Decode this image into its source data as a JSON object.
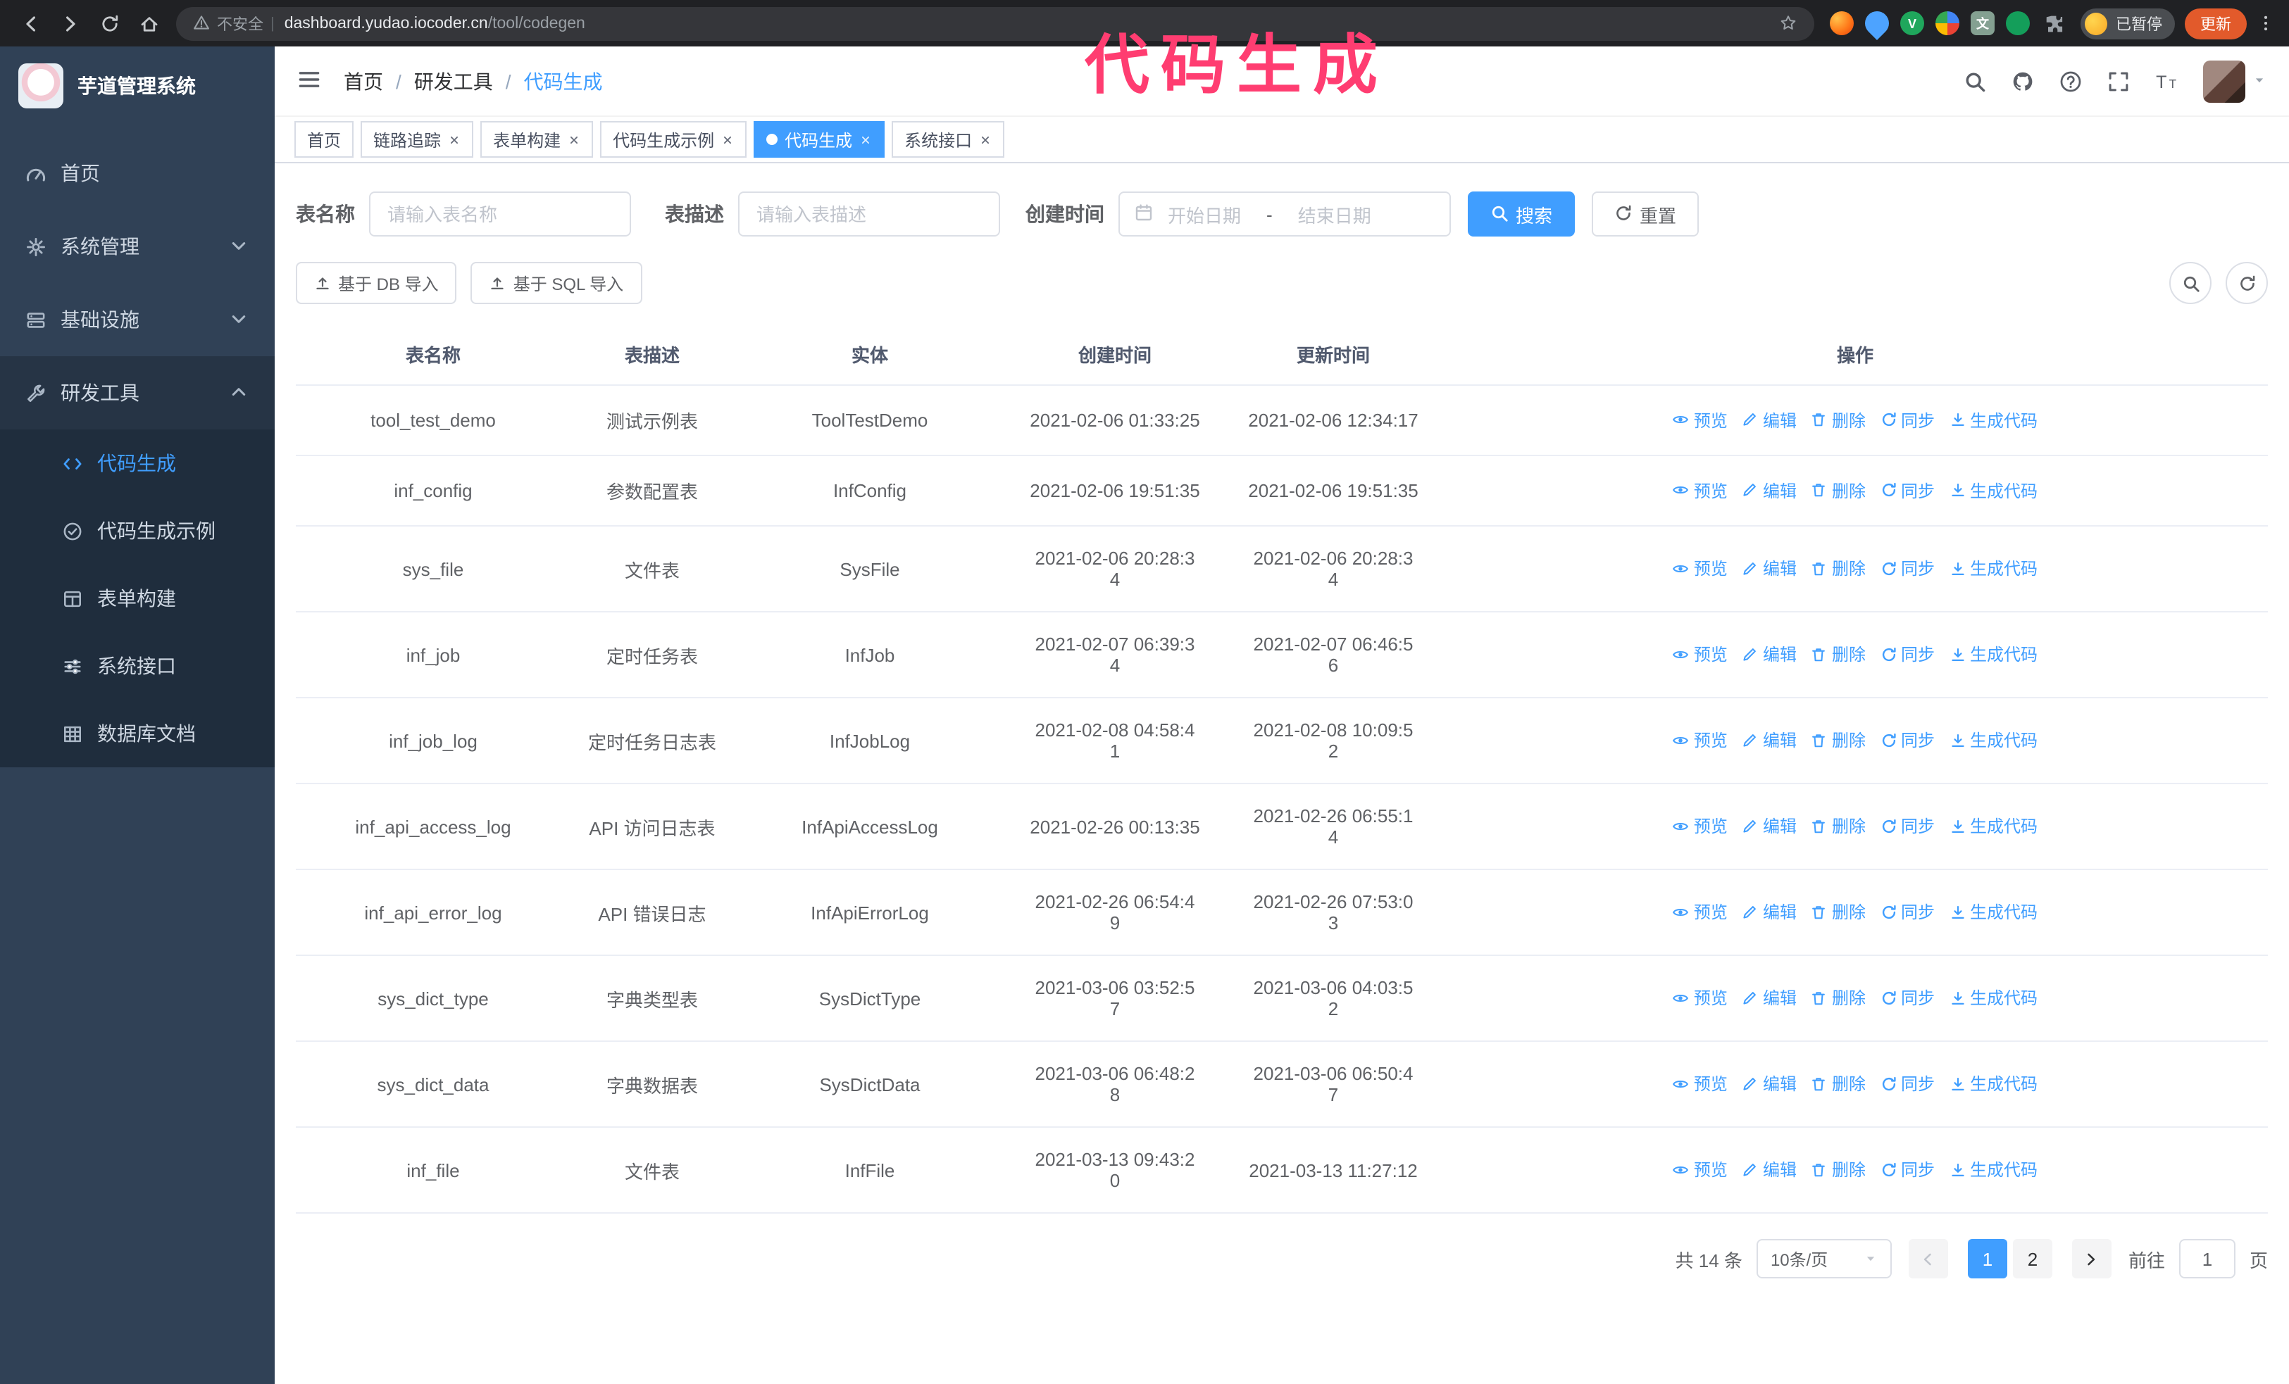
{
  "annotation": {
    "text": "代码生成"
  },
  "colors": {
    "accent": "#409eff",
    "sidebar_bg": "#304156",
    "submenu_bg": "#1f2d3d",
    "annotation": "#ff3d71",
    "update_button_bg": "#e25a2b",
    "chrome_bg": "#202124"
  },
  "browser": {
    "nav_icons": [
      "arrow-left-icon",
      "arrow-right-icon",
      "reload-icon",
      "home-icon"
    ],
    "warning_icon": "warning-icon",
    "security_label": "不安全",
    "url_domain": "dashboard.yudao.iocoder.cn",
    "url_path": "/tool/codegen",
    "bookmark_icon": "star-icon",
    "extensions": [
      {
        "name": "fox-extension-icon",
        "color": "#ff7a1a",
        "glyph": ""
      },
      {
        "name": "drop-extension-icon",
        "color": "#4da3ff",
        "glyph": ""
      },
      {
        "name": "check-extension-icon",
        "color": "#1fa75c",
        "glyph": "V"
      },
      {
        "name": "people-extension-icon",
        "color": "#4285f4",
        "glyph": ""
      },
      {
        "name": "translate-extension-icon",
        "color": "#84a091",
        "glyph": "文"
      },
      {
        "name": "leaf-extension-icon",
        "color": "#149e5a",
        "glyph": ""
      },
      {
        "name": "puzzle-extension-icon",
        "color": "#9aa0a6",
        "glyph": ""
      }
    ],
    "profile_badge": "已暂停",
    "update_button": "更新",
    "more_icon": "more-vert-icon"
  },
  "sidebar": {
    "logo_title": "芋道管理系统",
    "menu": [
      {
        "key": "home",
        "label": "首页",
        "icon": "dashboard-icon"
      },
      {
        "key": "system",
        "label": "系统管理",
        "icon": "gear-icon",
        "chevron": "down"
      },
      {
        "key": "infra",
        "label": "基础设施",
        "icon": "server-icon",
        "chevron": "down"
      },
      {
        "key": "devtools",
        "label": "研发工具",
        "icon": "wrench-icon",
        "chevron": "up",
        "open": true,
        "children": [
          {
            "key": "codegen",
            "label": "代码生成",
            "icon": "code-icon",
            "active": true
          },
          {
            "key": "codegen-example",
            "label": "代码生成示例",
            "icon": "badge-check-icon"
          },
          {
            "key": "form-builder",
            "label": "表单构建",
            "icon": "form-icon"
          },
          {
            "key": "system-api",
            "label": "系统接口",
            "icon": "sliders-icon"
          },
          {
            "key": "db-doc",
            "label": "数据库文档",
            "icon": "grid-icon"
          }
        ]
      }
    ]
  },
  "navbar": {
    "hamburger_icon": "hamburger-icon",
    "breadcrumb": [
      "首页",
      "研发工具",
      "代码生成"
    ],
    "right_icons": [
      "search-icon",
      "github-icon",
      "help-icon",
      "fullscreen-icon",
      "font-size-icon"
    ],
    "avatar_caret": "caret-down-icon"
  },
  "tabs": [
    {
      "key": "home",
      "label": "首页",
      "closable": false,
      "active": false
    },
    {
      "key": "trace",
      "label": "链路追踪",
      "closable": true,
      "active": false
    },
    {
      "key": "form-builder",
      "label": "表单构建",
      "closable": true,
      "active": false
    },
    {
      "key": "codegen-example",
      "label": "代码生成示例",
      "closable": true,
      "active": false
    },
    {
      "key": "codegen",
      "label": "代码生成",
      "closable": true,
      "active": true
    },
    {
      "key": "system-api",
      "label": "系统接口",
      "closable": true,
      "active": false
    }
  ],
  "filters": {
    "table_name_label": "表名称",
    "table_name_placeholder": "请输入表名称",
    "table_desc_label": "表描述",
    "table_desc_placeholder": "请输入表描述",
    "create_time_label": "创建时间",
    "calendar_icon": "calendar-icon",
    "date_start_placeholder": "开始日期",
    "date_separator": "-",
    "date_end_placeholder": "结束日期",
    "search_icon": "search-icon",
    "search_label": "搜索",
    "reset_icon": "reload-icon",
    "reset_label": "重置"
  },
  "toolbar": {
    "import_icon": "upload-icon",
    "import_db_label": "基于 DB 导入",
    "import_sql_label": "基于 SQL 导入",
    "circle_icons": [
      "search-icon",
      "reload-icon"
    ]
  },
  "table": {
    "columns": [
      "表名称",
      "表描述",
      "实体",
      "创建时间",
      "更新时间",
      "操作"
    ],
    "ops": [
      {
        "key": "preview",
        "label": "预览",
        "icon": "eye-icon"
      },
      {
        "key": "edit",
        "label": "编辑",
        "icon": "edit-icon"
      },
      {
        "key": "delete",
        "label": "删除",
        "icon": "delete-icon"
      },
      {
        "key": "sync",
        "label": "同步",
        "icon": "sync-icon"
      },
      {
        "key": "generate",
        "label": "生成代码",
        "icon": "download-icon"
      }
    ],
    "rows": [
      {
        "name": "tool_test_demo",
        "desc": "测试示例表",
        "entity": "ToolTestDemo",
        "created": "2021-02-06 01:33:25",
        "updated": "2021-02-06 12:34:17"
      },
      {
        "name": "inf_config",
        "desc": "参数配置表",
        "entity": "InfConfig",
        "created": "2021-02-06 19:51:35",
        "updated": "2021-02-06 19:51:35"
      },
      {
        "name": "sys_file",
        "desc": "文件表",
        "entity": "SysFile",
        "created": "2021-02-06 20:28:3\n4",
        "updated": "2021-02-06 20:28:3\n4"
      },
      {
        "name": "inf_job",
        "desc": "定时任务表",
        "entity": "InfJob",
        "created": "2021-02-07 06:39:3\n4",
        "updated": "2021-02-07 06:46:5\n6"
      },
      {
        "name": "inf_job_log",
        "desc": "定时任务日志表",
        "entity": "InfJobLog",
        "created": "2021-02-08 04:58:4\n1",
        "updated": "2021-02-08 10:09:5\n2"
      },
      {
        "name": "inf_api_access_log",
        "desc": "API 访问日志表",
        "entity": "InfApiAccessLog",
        "created": "2021-02-26 00:13:35",
        "updated": "2021-02-26 06:55:1\n4"
      },
      {
        "name": "inf_api_error_log",
        "desc": "API 错误日志",
        "entity": "InfApiErrorLog",
        "created": "2021-02-26 06:54:4\n9",
        "updated": "2021-02-26 07:53:0\n3"
      },
      {
        "name": "sys_dict_type",
        "desc": "字典类型表",
        "entity": "SysDictType",
        "created": "2021-03-06 03:52:5\n7",
        "updated": "2021-03-06 04:03:5\n2"
      },
      {
        "name": "sys_dict_data",
        "desc": "字典数据表",
        "entity": "SysDictData",
        "created": "2021-03-06 06:48:2\n8",
        "updated": "2021-03-06 06:50:4\n7"
      },
      {
        "name": "inf_file",
        "desc": "文件表",
        "entity": "InfFile",
        "created": "2021-03-13 09:43:2\n0",
        "updated": "2021-03-13 11:27:12"
      }
    ]
  },
  "pagination": {
    "total_label": "共 14 条",
    "page_size_value": "10条/页",
    "select_caret": "caret-down-icon",
    "prev_icon": "arrow-left-icon",
    "next_icon": "arrow-right-icon",
    "pages": [
      "1",
      "2"
    ],
    "active_page": "1",
    "goto_label": "前往",
    "goto_value": "1",
    "page_suffix": "页"
  }
}
